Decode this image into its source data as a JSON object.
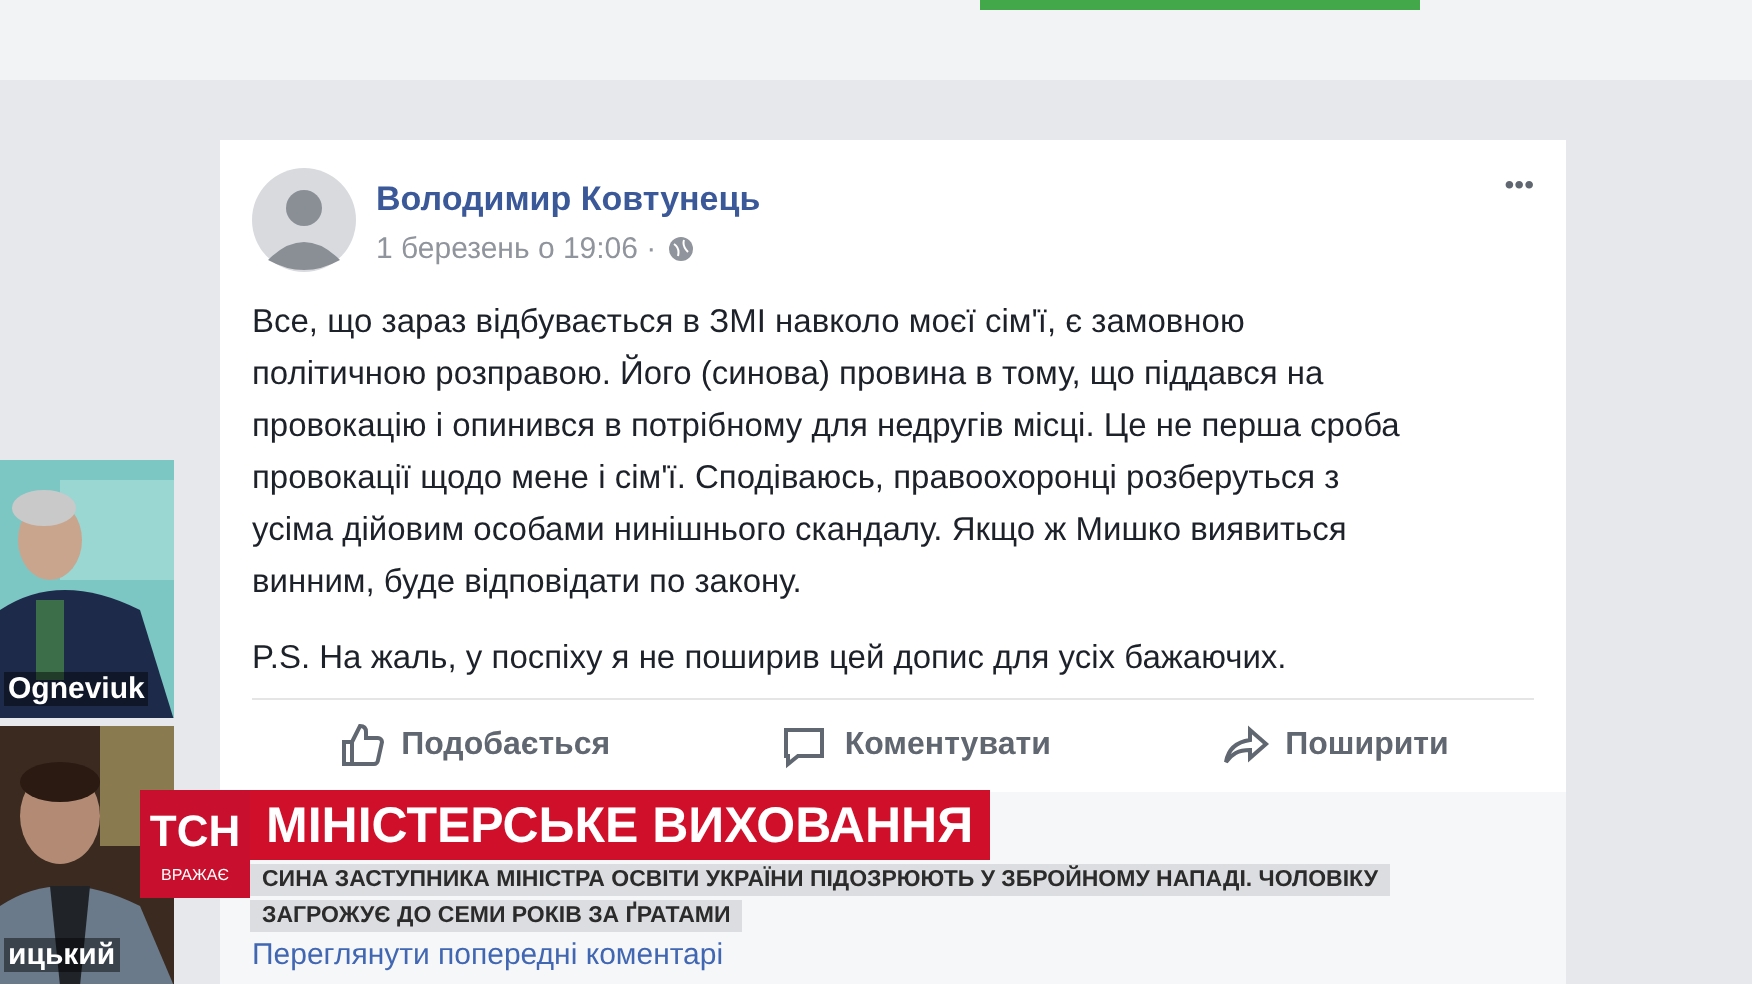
{
  "sidebar": {
    "thumbnails": [
      {
        "kind": "picture",
        "caption": "Ogneviuk"
      },
      {
        "kind": "picture",
        "caption": "ицький"
      }
    ]
  },
  "post": {
    "author": "Володимир Ковтунець",
    "date": "1 березень о 19:06 ·",
    "menu": "•••",
    "paragraphs": [
      [
        "Все, що зараз відбувається в ЗМІ навколо моєї сім'ї, є замовною",
        "політичною розправою. Його (синова) провина в тому, що піддався на",
        "провокацію і опинився в потрібному для недругів місці. Це не перша сроба",
        "провокації щодо мене і сім'ї. Сподіваюсь, правоохоронці розберуться з",
        "усіма дійовим особами нинішнього скандалу. Якщо ж Мишко виявиться",
        "винним, буде відповідати по закону."
      ],
      [
        "P.S. На жаль, у поспіху я не поширив цей допис для усіх бажаючих."
      ]
    ],
    "actions": [
      {
        "kind": "like",
        "label": "Подобається"
      },
      {
        "kind": "comment",
        "label": "Коментувати"
      },
      {
        "kind": "share",
        "label": "Поширити"
      }
    ],
    "more_comments": "Переглянути попередні коментарі"
  },
  "news_banner": {
    "logo": "ТСН",
    "logo_sub": "ВРАЖАЄ",
    "headline": "МІНІСТЕРСЬКЕ ВИХОВАННЯ",
    "subtitle_lines": [
      "СИНА ЗАСТУПНИКА МІНІСТРА ОСВІТИ УКРАЇНИ ПІДОЗРЮЮТЬ У ЗБРОЙНОМУ НАПАДІ. ЧОЛОВІКУ",
      "ЗАГРОЖУЄ ДО СЕМИ РОКІВ ЗА ҐРАТАМИ"
    ]
  }
}
